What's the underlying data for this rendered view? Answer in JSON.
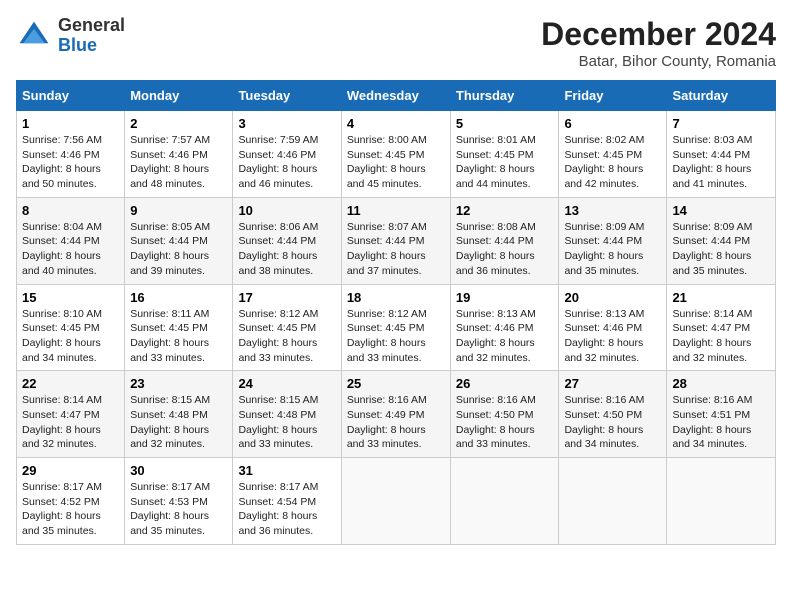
{
  "logo": {
    "general": "General",
    "blue": "Blue"
  },
  "title": "December 2024",
  "subtitle": "Batar, Bihor County, Romania",
  "calendar": {
    "headers": [
      "Sunday",
      "Monday",
      "Tuesday",
      "Wednesday",
      "Thursday",
      "Friday",
      "Saturday"
    ],
    "weeks": [
      [
        {
          "day": "1",
          "sunrise": "7:56 AM",
          "sunset": "4:46 PM",
          "daylight": "8 hours and 50 minutes."
        },
        {
          "day": "2",
          "sunrise": "7:57 AM",
          "sunset": "4:46 PM",
          "daylight": "8 hours and 48 minutes."
        },
        {
          "day": "3",
          "sunrise": "7:59 AM",
          "sunset": "4:46 PM",
          "daylight": "8 hours and 46 minutes."
        },
        {
          "day": "4",
          "sunrise": "8:00 AM",
          "sunset": "4:45 PM",
          "daylight": "8 hours and 45 minutes."
        },
        {
          "day": "5",
          "sunrise": "8:01 AM",
          "sunset": "4:45 PM",
          "daylight": "8 hours and 44 minutes."
        },
        {
          "day": "6",
          "sunrise": "8:02 AM",
          "sunset": "4:45 PM",
          "daylight": "8 hours and 42 minutes."
        },
        {
          "day": "7",
          "sunrise": "8:03 AM",
          "sunset": "4:44 PM",
          "daylight": "8 hours and 41 minutes."
        }
      ],
      [
        {
          "day": "8",
          "sunrise": "8:04 AM",
          "sunset": "4:44 PM",
          "daylight": "8 hours and 40 minutes."
        },
        {
          "day": "9",
          "sunrise": "8:05 AM",
          "sunset": "4:44 PM",
          "daylight": "8 hours and 39 minutes."
        },
        {
          "day": "10",
          "sunrise": "8:06 AM",
          "sunset": "4:44 PM",
          "daylight": "8 hours and 38 minutes."
        },
        {
          "day": "11",
          "sunrise": "8:07 AM",
          "sunset": "4:44 PM",
          "daylight": "8 hours and 37 minutes."
        },
        {
          "day": "12",
          "sunrise": "8:08 AM",
          "sunset": "4:44 PM",
          "daylight": "8 hours and 36 minutes."
        },
        {
          "day": "13",
          "sunrise": "8:09 AM",
          "sunset": "4:44 PM",
          "daylight": "8 hours and 35 minutes."
        },
        {
          "day": "14",
          "sunrise": "8:09 AM",
          "sunset": "4:44 PM",
          "daylight": "8 hours and 35 minutes."
        }
      ],
      [
        {
          "day": "15",
          "sunrise": "8:10 AM",
          "sunset": "4:45 PM",
          "daylight": "8 hours and 34 minutes."
        },
        {
          "day": "16",
          "sunrise": "8:11 AM",
          "sunset": "4:45 PM",
          "daylight": "8 hours and 33 minutes."
        },
        {
          "day": "17",
          "sunrise": "8:12 AM",
          "sunset": "4:45 PM",
          "daylight": "8 hours and 33 minutes."
        },
        {
          "day": "18",
          "sunrise": "8:12 AM",
          "sunset": "4:45 PM",
          "daylight": "8 hours and 33 minutes."
        },
        {
          "day": "19",
          "sunrise": "8:13 AM",
          "sunset": "4:46 PM",
          "daylight": "8 hours and 32 minutes."
        },
        {
          "day": "20",
          "sunrise": "8:13 AM",
          "sunset": "4:46 PM",
          "daylight": "8 hours and 32 minutes."
        },
        {
          "day": "21",
          "sunrise": "8:14 AM",
          "sunset": "4:47 PM",
          "daylight": "8 hours and 32 minutes."
        }
      ],
      [
        {
          "day": "22",
          "sunrise": "8:14 AM",
          "sunset": "4:47 PM",
          "daylight": "8 hours and 32 minutes."
        },
        {
          "day": "23",
          "sunrise": "8:15 AM",
          "sunset": "4:48 PM",
          "daylight": "8 hours and 32 minutes."
        },
        {
          "day": "24",
          "sunrise": "8:15 AM",
          "sunset": "4:48 PM",
          "daylight": "8 hours and 33 minutes."
        },
        {
          "day": "25",
          "sunrise": "8:16 AM",
          "sunset": "4:49 PM",
          "daylight": "8 hours and 33 minutes."
        },
        {
          "day": "26",
          "sunrise": "8:16 AM",
          "sunset": "4:50 PM",
          "daylight": "8 hours and 33 minutes."
        },
        {
          "day": "27",
          "sunrise": "8:16 AM",
          "sunset": "4:50 PM",
          "daylight": "8 hours and 34 minutes."
        },
        {
          "day": "28",
          "sunrise": "8:16 AM",
          "sunset": "4:51 PM",
          "daylight": "8 hours and 34 minutes."
        }
      ],
      [
        {
          "day": "29",
          "sunrise": "8:17 AM",
          "sunset": "4:52 PM",
          "daylight": "8 hours and 35 minutes."
        },
        {
          "day": "30",
          "sunrise": "8:17 AM",
          "sunset": "4:53 PM",
          "daylight": "8 hours and 35 minutes."
        },
        {
          "day": "31",
          "sunrise": "8:17 AM",
          "sunset": "4:54 PM",
          "daylight": "8 hours and 36 minutes."
        },
        null,
        null,
        null,
        null
      ]
    ]
  }
}
